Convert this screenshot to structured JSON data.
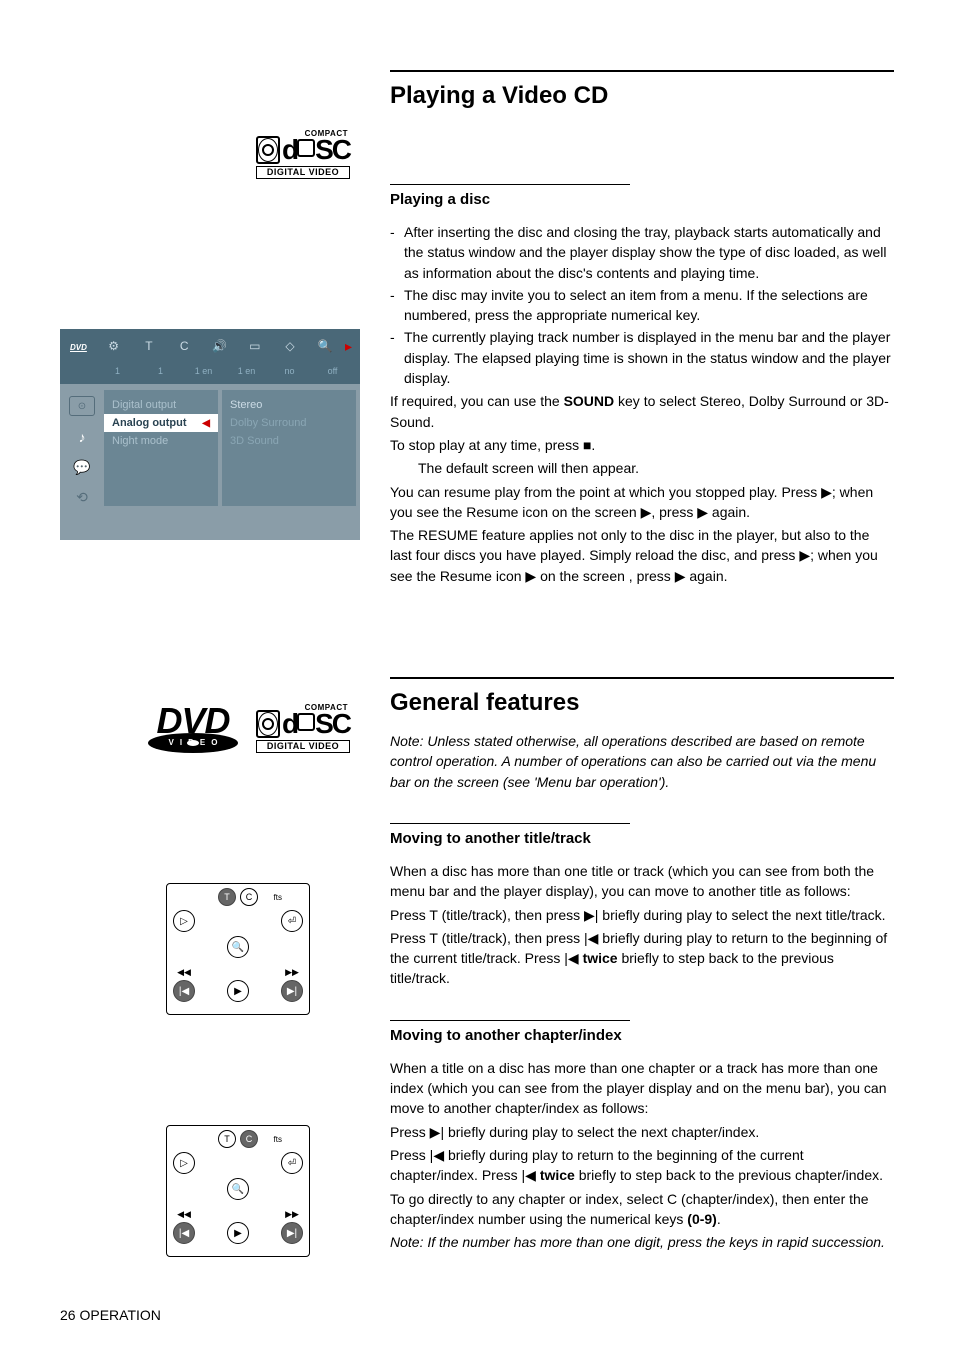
{
  "section1": {
    "title": "Playing a Video CD",
    "sub1_title": "Playing a disc",
    "bullets": [
      "After inserting the disc and closing the tray, playback starts automatically and the status window and the player display show the type of disc loaded, as well as information about the disc's contents and playing time.",
      "The disc may invite you to select an item from a menu. If the selections are numbered, press the appropriate numerical key.",
      "The currently playing track number is displayed in the menu bar and the player display. The elapsed playing time is shown in the status window and the player display."
    ],
    "p_sound_pre": "If required, you can use the ",
    "p_sound_bold": "SOUND",
    "p_sound_post": " key to select Stereo, Dolby Surround or 3D-Sound.",
    "p_stop": "To stop play at any time, press ■.",
    "p_default": "The default screen will then appear.",
    "p_resume1": "You can resume play from the point at which you stopped play. Press ▶; when you see the Resume icon on the screen ▶, press ▶ again.",
    "p_resume2": "The RESUME feature applies not only to the disc in the player, but also to the last four discs you have played. Simply reload the disc, and press ▶; when you see the Resume icon ▶ on the screen , press ▶ again."
  },
  "section2": {
    "title": "General features",
    "note": "Note: Unless stated otherwise, all operations described are based on remote control operation. A number of operations can also be carried out via the menu bar on the screen (see 'Menu bar operation').",
    "sub1": {
      "title": "Moving to another title/track",
      "p1": "When a disc has more than one title or track (which you can see from both the menu bar and the player display), you can move to another title as follows:",
      "p2": "Press T (title/track), then press ▶| briefly during play to select the next title/track.",
      "p3_pre": "Press T (title/track), then press |◀ briefly during play to return to the beginning of the current title/track. Press |◀ ",
      "p3_bold": "twice",
      "p3_post": " briefly to step back to the previous title/track."
    },
    "sub2": {
      "title": "Moving to another chapter/index",
      "p1": "When a title on a disc has more than one chapter or a track has more than one index (which you can see from the player display and on the menu bar), you can move to another chapter/index as follows:",
      "p2": "Press ▶| briefly during play to select the next chapter/index.",
      "p3_pre": "Press |◀ briefly during play to return to the beginning of the current chapter/index. Press |◀ ",
      "p3_bold": "twice",
      "p3_post": " briefly to step back to the previous chapter/index.",
      "p4_pre": "To go directly to any chapter or index, select C (chapter/index), then enter the chapter/index number using the numerical keys ",
      "p4_bold": "(0-9)",
      "p4_post": ".",
      "note": "Note: If the number has more than one digit, press the keys in rapid succession."
    }
  },
  "logos": {
    "compact": "COMPACT",
    "disc_left_char": "d",
    "disc_right": "SC",
    "digital_video": "DIGITAL VIDEO",
    "dvd": "DVD",
    "video": "VIDEO"
  },
  "osd": {
    "badge": "DVD",
    "top_icons": [
      "⚙",
      "T",
      "C",
      "🔊",
      "▭",
      "◇",
      "🔍"
    ],
    "sub_row": [
      "",
      "1",
      "1",
      "1 en",
      "1 en",
      "no",
      "off"
    ],
    "tabs": [
      "▭",
      "♪",
      "💬",
      "⟲"
    ],
    "colA": [
      "Digital output",
      "Analog output",
      "Night mode"
    ],
    "colB": [
      "Stereo",
      "Dolby Surround",
      "3D Sound"
    ]
  },
  "remote": {
    "row1": [
      "T",
      "C",
      "fts"
    ],
    "row2_left": "▷",
    "row2_right": "⏎",
    "row3_mid": "🔍",
    "row4": [
      "|◀",
      "▶",
      "▶|"
    ],
    "arrows": {
      "rev": "◀◀",
      "fwd": "▶▶"
    }
  },
  "footer": {
    "page": "26",
    "label": "OPERATION"
  }
}
